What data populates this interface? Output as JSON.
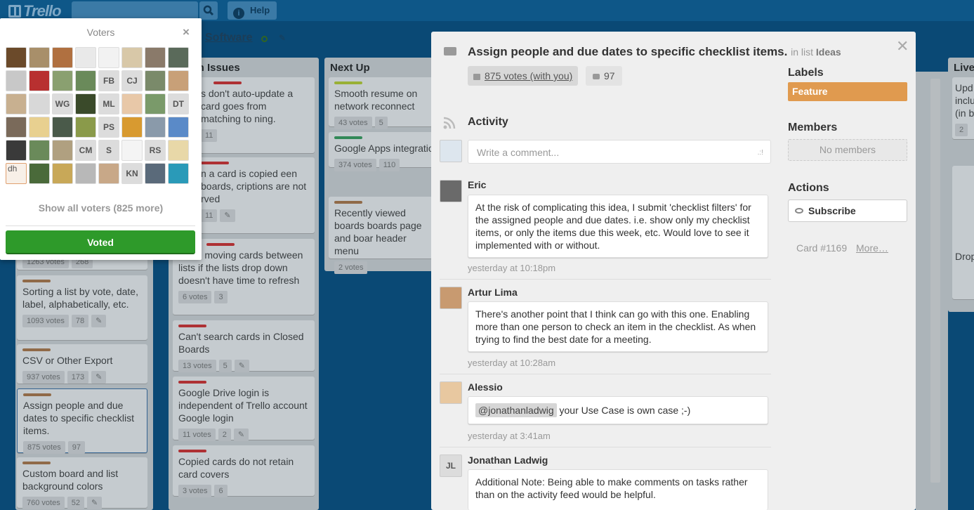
{
  "header": {
    "logo": "Trello",
    "help_label": "Help",
    "help_icon": "i"
  },
  "board": {
    "title": "Software"
  },
  "lists": [
    {
      "title": "wn Issues",
      "cards": [
        {
          "text": "s don't auto-update a card goes from matching to ning.",
          "votes": "",
          "comments": "11"
        },
        {
          "text": "n a card is copied een boards, criptions are not rved",
          "votes": "",
          "comments": "11"
        },
        {
          "text": "when moving cards between lists if the lists drop down doesn't have time to refresh",
          "votes": "6 votes",
          "comments": "3"
        },
        {
          "text": "Can't search cards in Closed Boards",
          "votes": "13 votes",
          "comments": "5"
        },
        {
          "text": "Google Drive login is independent of Trello account Google login",
          "votes": "11 votes",
          "comments": "2"
        },
        {
          "text": "Copied cards do not retain card covers",
          "votes": "3 votes",
          "comments": "6"
        }
      ]
    },
    {
      "title": "Next Up",
      "cards": [
        {
          "text": "Smooth resume on network reconnect",
          "votes": "43 votes",
          "comments": "5"
        },
        {
          "text": "Google Apps integratio",
          "votes": "374 votes",
          "comments": "110"
        },
        {
          "text": "Recently viewed boards boards page and boar header menu",
          "votes": "2 votes",
          "comments": ""
        }
      ]
    },
    {
      "title": "",
      "cards": [
        {
          "text": "",
          "votes": "1263 votes",
          "comments": "268"
        },
        {
          "text": "Sorting a list by vote, date, label, alphabetically, etc.",
          "votes": "1093 votes",
          "comments": "78"
        },
        {
          "text": "CSV or Other Export",
          "votes": "937 votes",
          "comments": "173"
        },
        {
          "text": "Assign people and due dates to specific checklist items.",
          "votes": "875 votes",
          "comments": "97"
        },
        {
          "text": "Custom board and list background colors",
          "votes": "760 votes",
          "comments": "52"
        }
      ]
    },
    {
      "title": "Live",
      "cards": [
        {
          "text": "Upd inclu (in b",
          "votes": "2",
          "comments": ""
        },
        {
          "text": "Drop",
          "votes": "",
          "comments": ""
        }
      ]
    }
  ],
  "voters": {
    "title": "Voters",
    "close": "×",
    "initials": [
      "FB",
      "CJ",
      "WG",
      "ML",
      "DT",
      "PS",
      "CM",
      "S",
      "RS",
      "dh",
      "KN"
    ],
    "show_all": "Show all voters (825 more)",
    "voted_label": "Voted"
  },
  "detail": {
    "title": "Assign people and due dates to specific checklist items.",
    "in_list_prefix": "in list",
    "list_name": "Ideas",
    "votes_label": "875 votes (with you)",
    "comments_count": "97",
    "activity_title": "Activity",
    "comment_placeholder": "Write a comment...",
    "comments": [
      {
        "author": "Eric",
        "text": "At the risk of complicating this idea, I submit 'checklist filters' for the assigned people and due dates. i.e. show only my checklist items, or only the items due this week, etc. Would love to see it implemented with or without.",
        "time": "yesterday at 10:18pm"
      },
      {
        "author": "Artur Lima",
        "text": "There's another point that I think can go with this one. Enabling more than one person to check an item in the checklist. As when trying to find the best date for a meeting.",
        "time": "yesterday at 10:28am"
      },
      {
        "author": "Alessio",
        "mention": "@jonathanladwig",
        "text": " your Use Case is own case ;-)",
        "time": "yesterday at 3:41am"
      },
      {
        "author": "Jonathan Ladwig",
        "initials": "JL",
        "text": "Additional Note: Being able to make comments on tasks rather than on the activity feed would be helpful.",
        "time": ""
      }
    ],
    "labels_title": "Labels",
    "label": "Feature",
    "members_title": "Members",
    "no_members": "No members",
    "actions_title": "Actions",
    "subscribe": "Subscribe",
    "card_number": "Card #1169",
    "more": "More…"
  },
  "colors": {
    "label_orange": "#e09a4f",
    "voted_green": "#2e9a2a",
    "header_blue": "#0e5788"
  }
}
